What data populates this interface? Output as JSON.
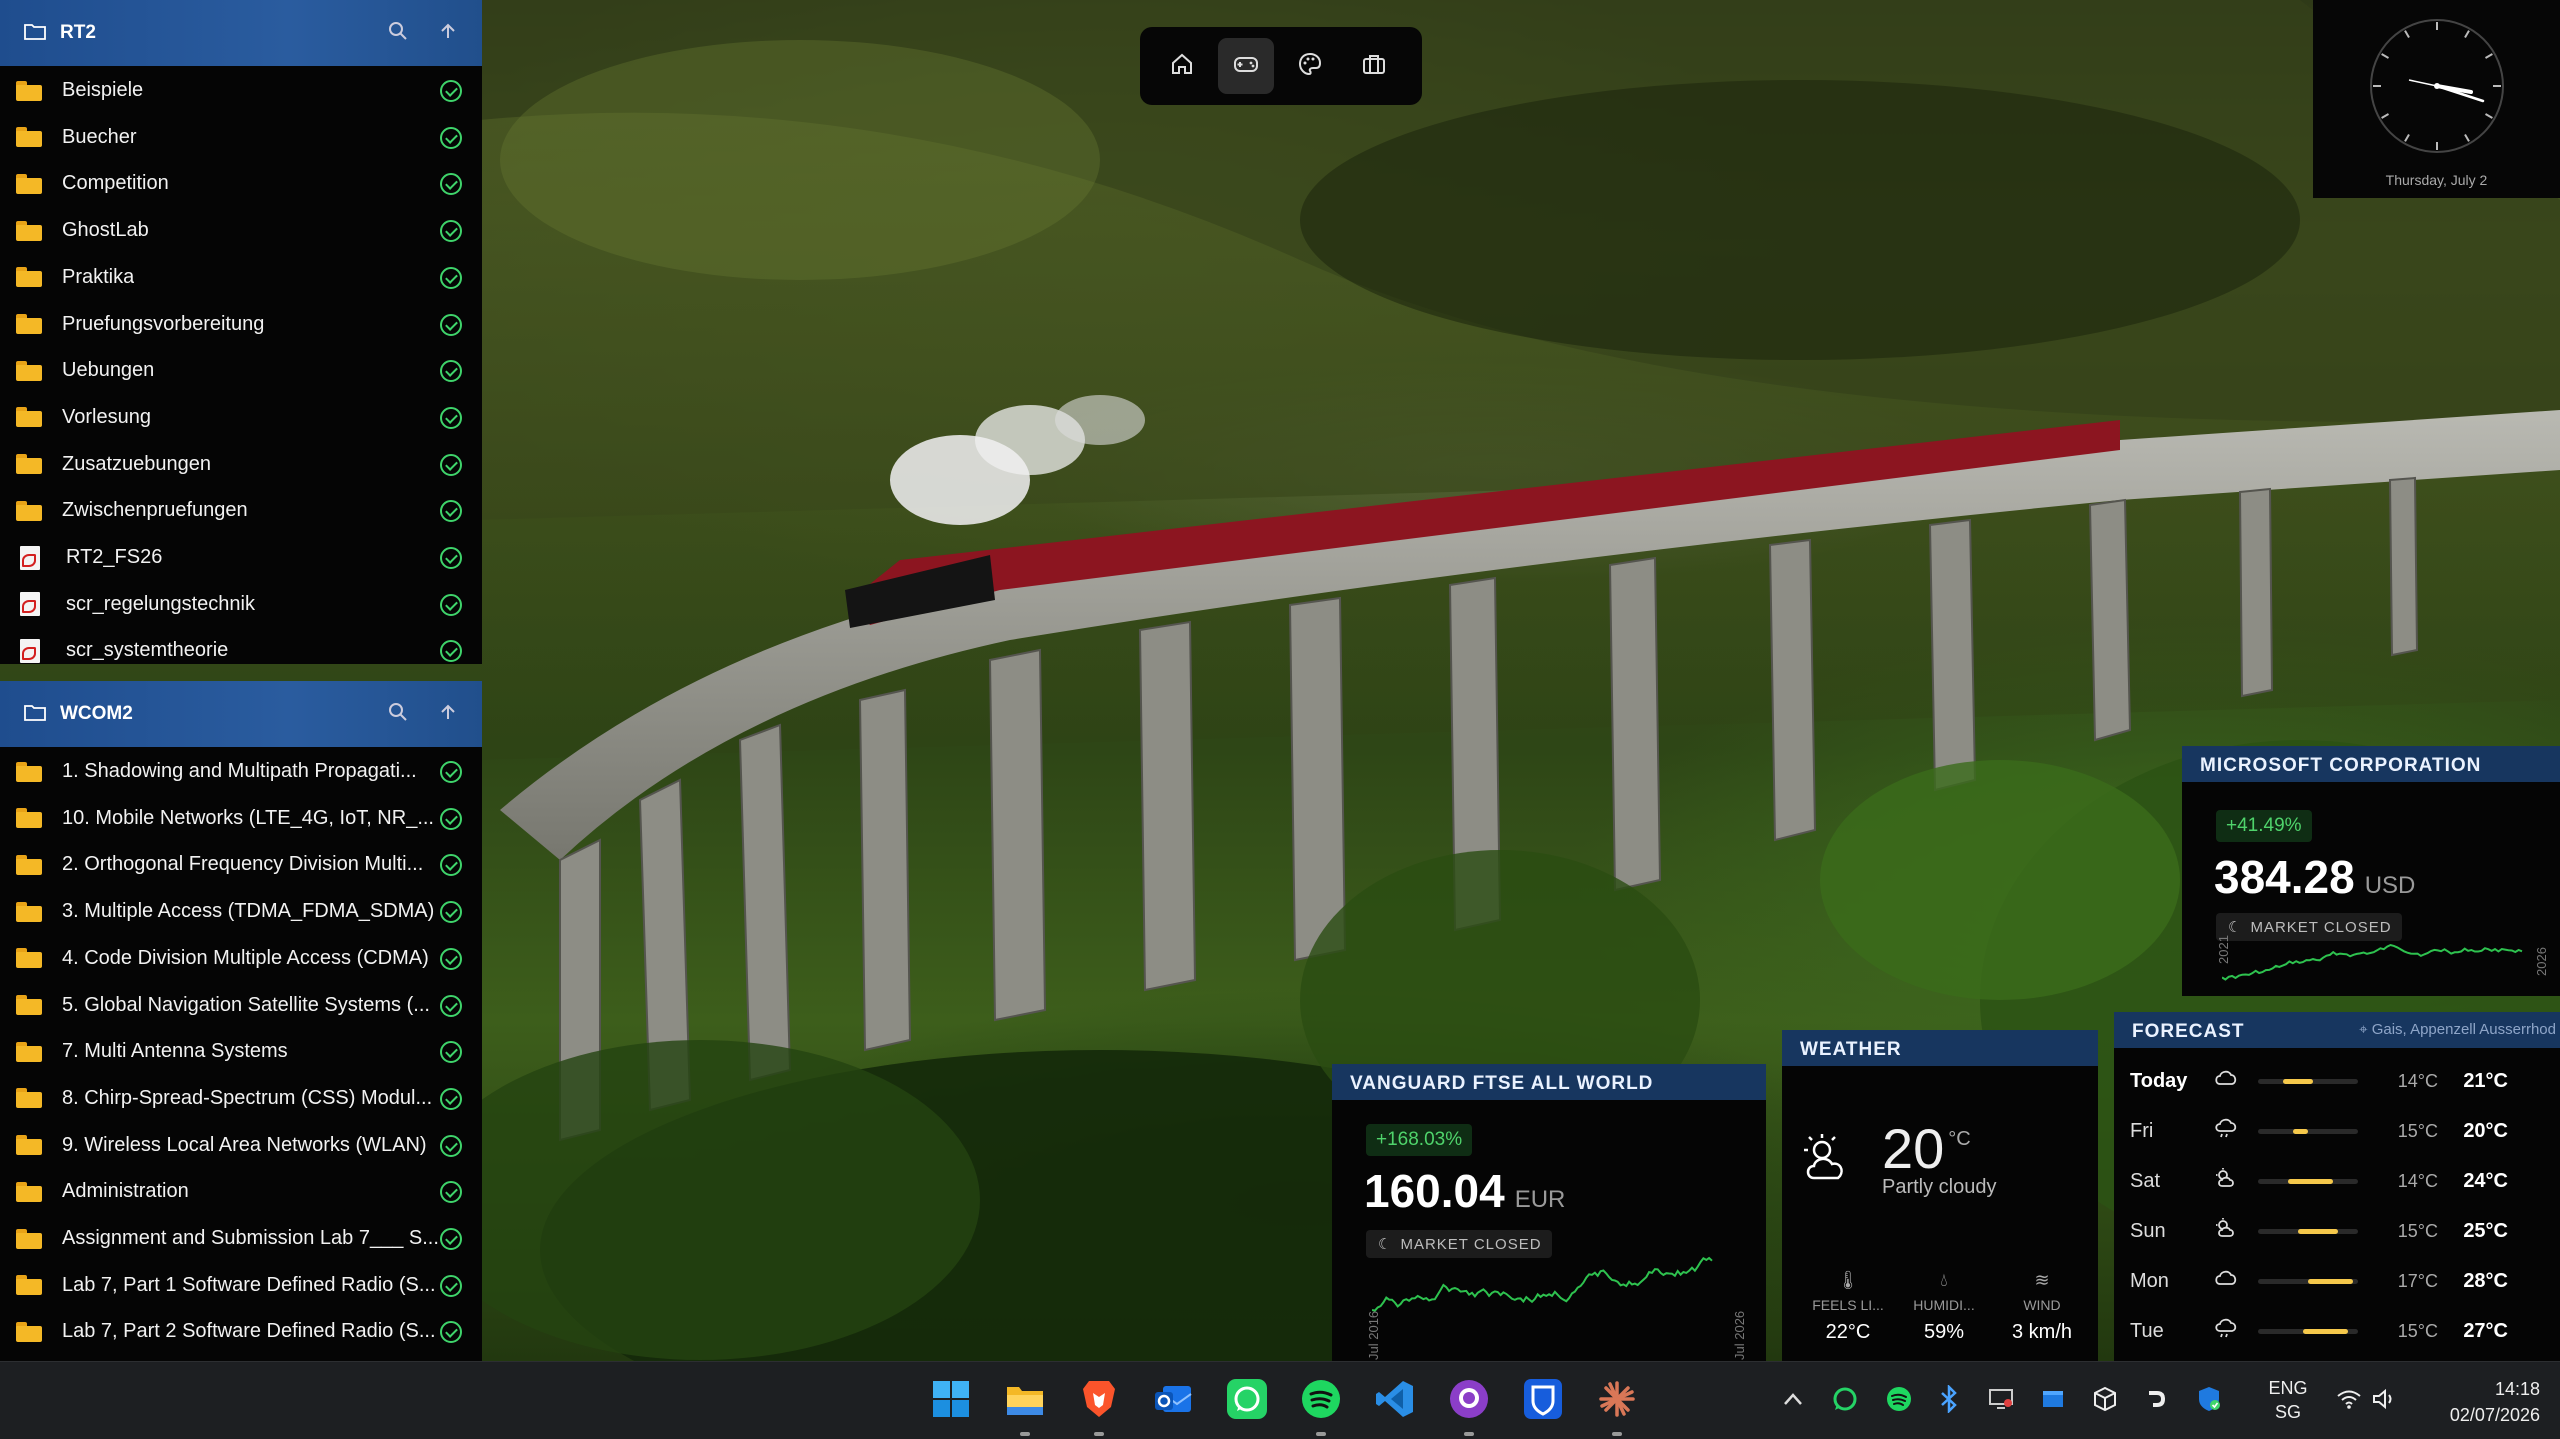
{
  "explorer_rt2": {
    "title": "RT2",
    "items": [
      {
        "name": "Beispiele",
        "type": "folder"
      },
      {
        "name": "Buecher",
        "type": "folder"
      },
      {
        "name": "Competition",
        "type": "folder"
      },
      {
        "name": "GhostLab",
        "type": "folder"
      },
      {
        "name": "Praktika",
        "type": "folder"
      },
      {
        "name": "Pruefungsvorbereitung",
        "type": "folder"
      },
      {
        "name": "Uebungen",
        "type": "folder"
      },
      {
        "name": "Vorlesung",
        "type": "folder"
      },
      {
        "name": "Zusatzuebungen",
        "type": "folder"
      },
      {
        "name": "Zwischenpruefungen",
        "type": "folder"
      },
      {
        "name": "RT2_FS26",
        "type": "pdf"
      },
      {
        "name": "scr_regelungstechnik",
        "type": "pdf"
      },
      {
        "name": "scr_systemtheorie",
        "type": "pdf"
      }
    ]
  },
  "explorer_wcom2": {
    "title": "WCOM2",
    "items": [
      {
        "name": "1. Shadowing and Multipath Propagati...",
        "type": "folder"
      },
      {
        "name": "10. Mobile Networks (LTE_4G, IoT, NR_...",
        "type": "folder"
      },
      {
        "name": "2. Orthogonal Frequency Division Multi...",
        "type": "folder"
      },
      {
        "name": "3. Multiple Access (TDMA_FDMA_SDMA)",
        "type": "folder"
      },
      {
        "name": "4. Code Division Multiple Access (CDMA)",
        "type": "folder"
      },
      {
        "name": "5. Global Navigation Satellite Systems (...",
        "type": "folder"
      },
      {
        "name": "7. Multi Antenna Systems",
        "type": "folder"
      },
      {
        "name": "8. Chirp-Spread-Spectrum (CSS) Modul...",
        "type": "folder"
      },
      {
        "name": "9. Wireless Local Area Networks (WLAN)",
        "type": "folder"
      },
      {
        "name": "Administration",
        "type": "folder"
      },
      {
        "name": "Assignment and Submission Lab 7___ S...",
        "type": "folder"
      },
      {
        "name": "Lab 7, Part 1 Software Defined Radio (S...",
        "type": "folder"
      },
      {
        "name": "Lab 7, Part 2 Software Defined Radio (S...",
        "type": "folder"
      }
    ]
  },
  "top_dock": {
    "icons": [
      "home-icon",
      "gamepad-icon",
      "palette-icon",
      "briefcase-icon"
    ],
    "active": 1
  },
  "clock": {
    "date": "Thursday, July 2",
    "time_shown": "14:18"
  },
  "msft": {
    "title": "MICROSOFT CORPORATION",
    "change": "+41.49%",
    "price": "384.28",
    "currency": "USD",
    "status": "MARKET CLOSED",
    "x_start": "2021",
    "x_end": "2026"
  },
  "vanguard": {
    "title": "VANGUARD FTSE ALL WORLD",
    "change": "+168.03%",
    "price": "160.04",
    "currency": "EUR",
    "status": "MARKET CLOSED",
    "x_start": "Jul 2016",
    "x_end": "Jul 2026"
  },
  "weather": {
    "title": "WEATHER",
    "temp": "20",
    "unit": "°C",
    "condition": "Partly cloudy",
    "feels_label": "FEELS LI...",
    "feels_value": "22°C",
    "humidity_label": "HUMIDI...",
    "humidity_value": "59%",
    "wind_label": "WIND",
    "wind_value": "3 km/h"
  },
  "forecast": {
    "title": "FORECAST",
    "location": "Gais, Appenzell Ausserrhod",
    "days": [
      {
        "day": "Today",
        "low": "14°C",
        "high": "21°C",
        "bar_start": 0.25,
        "bar_end": 0.55,
        "icon": "cloud-icon"
      },
      {
        "day": "Fri",
        "low": "15°C",
        "high": "20°C",
        "bar_start": 0.35,
        "bar_end": 0.5,
        "icon": "rain-icon"
      },
      {
        "day": "Sat",
        "low": "14°C",
        "high": "24°C",
        "bar_start": 0.3,
        "bar_end": 0.75,
        "icon": "sun-cloud-icon"
      },
      {
        "day": "Sun",
        "low": "15°C",
        "high": "25°C",
        "bar_start": 0.4,
        "bar_end": 0.8,
        "icon": "sun-cloud-icon"
      },
      {
        "day": "Mon",
        "low": "17°C",
        "high": "28°C",
        "bar_start": 0.5,
        "bar_end": 0.95,
        "icon": "cloud-icon"
      },
      {
        "day": "Tue",
        "low": "15°C",
        "high": "27°C",
        "bar_start": 0.45,
        "bar_end": 0.9,
        "icon": "rain-icon"
      }
    ]
  },
  "taskbar": {
    "apps": [
      "start-icon",
      "file-explorer-icon",
      "brave-icon",
      "outlook-icon",
      "whatsapp-icon",
      "spotify-icon",
      "vscode-icon",
      "github-desktop-icon",
      "bitwarden-icon",
      "claude-icon"
    ],
    "tray": [
      "chevron-up-icon",
      "whatsapp-tray-icon",
      "spotify-tray-icon",
      "bluetooth-icon",
      "display-icon",
      "windows-tray-icon",
      "cube-icon",
      "game-icon",
      "defender-icon"
    ],
    "lang": "ENG",
    "region": "SG",
    "time": "14:18",
    "date": "02/07/2026"
  },
  "colors": {
    "accent": "#1f4d8e",
    "check": "#3fd46b",
    "gain": "#4fd36b",
    "widget_header": "#17365f"
  }
}
